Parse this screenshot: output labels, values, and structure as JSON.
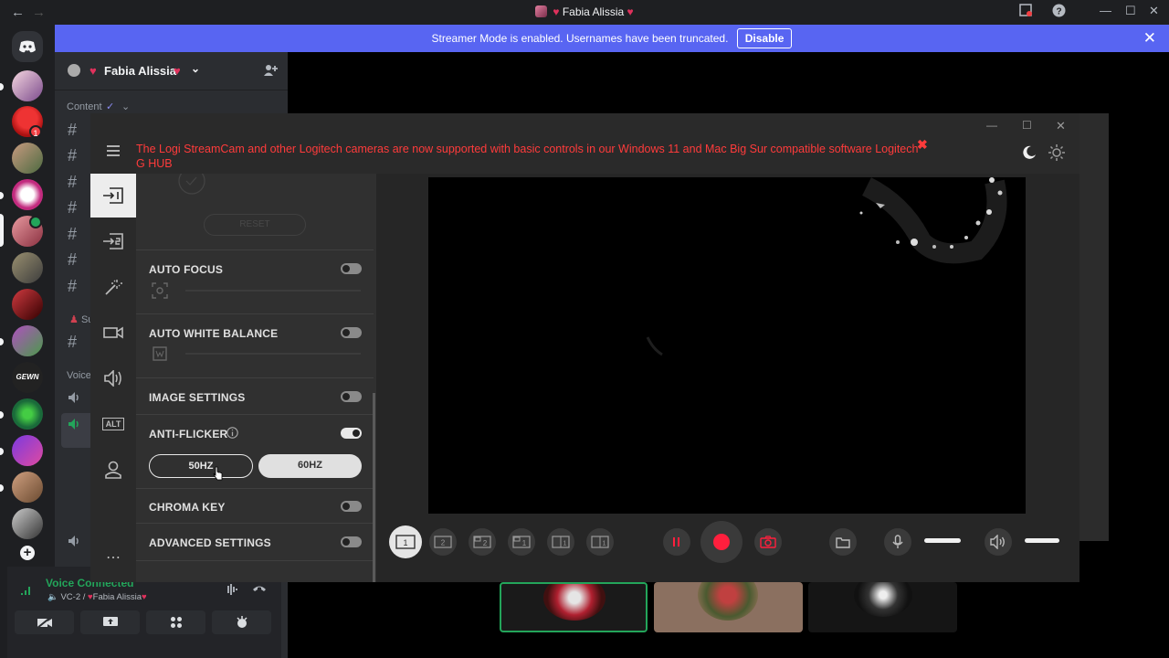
{
  "titlebar": {
    "title": "Fabia Alissia",
    "back": "←",
    "forward": "→"
  },
  "banner": {
    "text": "Streamer Mode is enabled. Usernames have been truncated.",
    "button": "Disable"
  },
  "rail": {
    "badges": [
      "1"
    ]
  },
  "server": {
    "name": "Fabia Alissia",
    "category": "Content",
    "voice_label": "Voice",
    "section_letter": "Su"
  },
  "voice_status": {
    "title": "Voice Connected",
    "channel": "VC-2 / ",
    "server": "Fabia Alissia"
  },
  "logi": {
    "notice": "The Logi StreamCam and other Logitech cameras are now supported with basic controls in our Windows 11 and Mac Big Sur compatible software Logitech G HUB",
    "reset": "RESET",
    "settings": [
      {
        "label": "AUTO FOCUS",
        "on": false
      },
      {
        "label": "AUTO WHITE BALANCE",
        "on": false
      },
      {
        "label": "IMAGE SETTINGS",
        "on": false
      },
      {
        "label": "ANTI-FLICKER",
        "on": true
      },
      {
        "label": "CHROMA KEY",
        "on": false
      },
      {
        "label": "ADVANCED SETTINGS",
        "on": false
      }
    ],
    "hz": {
      "opt1": "50HZ",
      "opt2": "60HZ",
      "selected": "50HZ"
    },
    "alt_label": "ALT",
    "more": "⋯",
    "layouts": [
      "1",
      "2",
      "2",
      "1",
      "1",
      "1"
    ]
  },
  "colors": {
    "accent": "#5865f2",
    "notice_red": "#ff3b3b",
    "record": "#ff1f3d",
    "voice_green": "#23a55a"
  }
}
